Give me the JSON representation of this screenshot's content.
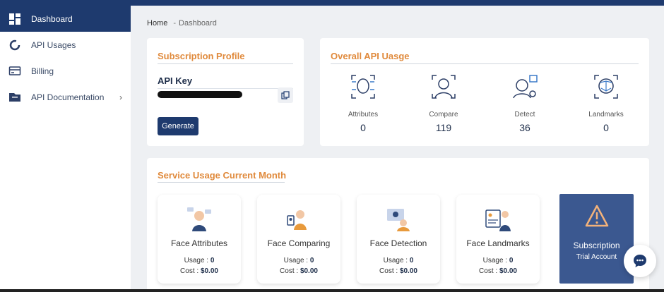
{
  "sidebar": {
    "items": [
      {
        "label": "Dashboard",
        "icon": "dashboard-icon",
        "active": true
      },
      {
        "label": "API Usages",
        "icon": "donut-chart-icon"
      },
      {
        "label": "Billing",
        "icon": "billing-icon"
      },
      {
        "label": "API Documentation",
        "icon": "documentation-icon",
        "chevron": "›"
      }
    ]
  },
  "breadcrumb": {
    "home": "Home",
    "separator": "-",
    "current": "Dashboard"
  },
  "subscription_profile": {
    "title": "Subscription Profile",
    "api_key_label": "API Key",
    "generate_label": "Generate"
  },
  "overall_usage": {
    "title": "Overall API Uasge",
    "stats": [
      {
        "label": "Attributes",
        "value": "0",
        "icon": "face-attributes-icon"
      },
      {
        "label": "Compare",
        "value": "119",
        "icon": "face-compare-icon"
      },
      {
        "label": "Detect",
        "value": "36",
        "icon": "face-detect-icon"
      },
      {
        "label": "Landmarks",
        "value": "0",
        "icon": "face-landmarks-icon"
      }
    ]
  },
  "service_usage": {
    "title": "Service Usage Current Month",
    "usage_label": "Usage :",
    "cost_label": "Cost :",
    "services": [
      {
        "name": "Face Attributes",
        "usage": "0",
        "cost": "$0.00"
      },
      {
        "name": "Face Comparing",
        "usage": "0",
        "cost": "$0.00"
      },
      {
        "name": "Face Detection",
        "usage": "0",
        "cost": "$0.00"
      },
      {
        "name": "Face Landmarks",
        "usage": "0",
        "cost": "$0.00"
      }
    ],
    "subscription": {
      "title": "Subscription",
      "plan": "Trial Account"
    }
  },
  "colors": {
    "primary": "#1e3a6e",
    "accent": "#e08a3c",
    "subscription_bg": "#3b5890"
  }
}
